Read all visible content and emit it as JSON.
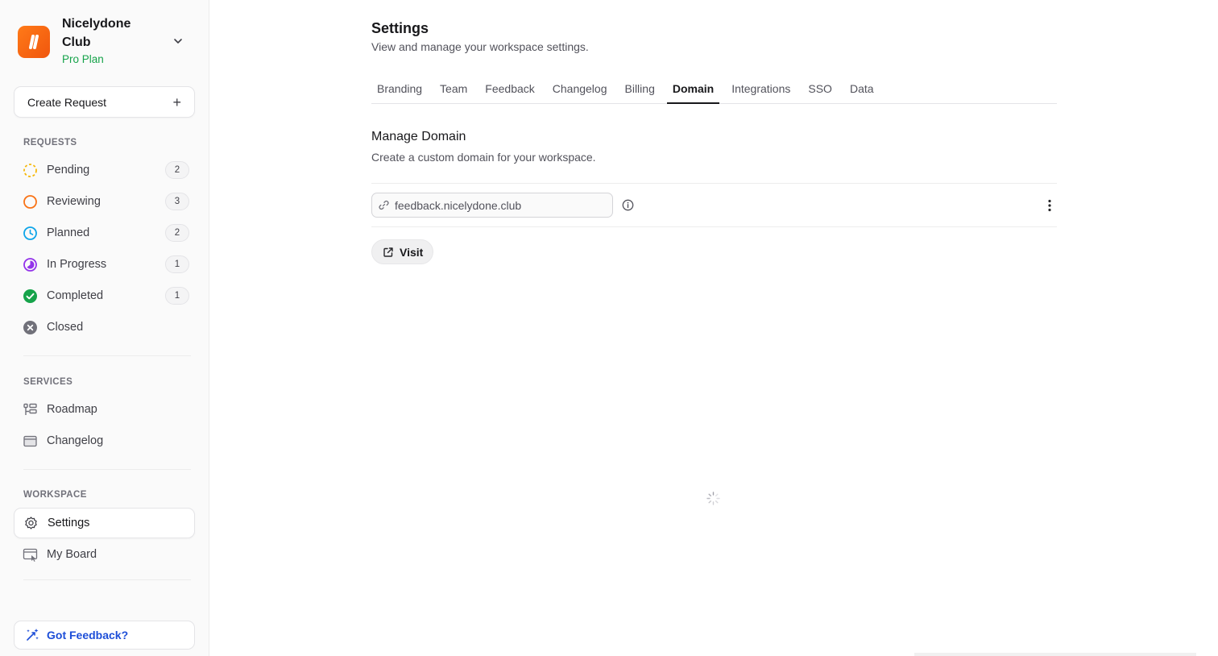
{
  "workspace": {
    "name": "Nicelydone Club",
    "plan": "Pro Plan",
    "accent": "#f97316"
  },
  "sidebar": {
    "create_label": "Create Request",
    "requests_label": "REQUESTS",
    "requests": [
      {
        "label": "Pending",
        "count": "2",
        "icon": "pending-dashed-circle-icon",
        "color": "#f5b80b"
      },
      {
        "label": "Reviewing",
        "count": "3",
        "icon": "reviewing-circle-icon",
        "color": "#f97316"
      },
      {
        "label": "Planned",
        "count": "2",
        "icon": "planned-clock-icon",
        "color": "#0ea5e9"
      },
      {
        "label": "In Progress",
        "count": "1",
        "icon": "in-progress-half-circle-icon",
        "color": "#9333ea"
      },
      {
        "label": "Completed",
        "count": "1",
        "icon": "completed-check-circle-icon",
        "color": "#16a34a"
      },
      {
        "label": "Closed",
        "icon": "closed-x-circle-icon",
        "color": "#71717a"
      }
    ],
    "services_label": "SERVICES",
    "services": [
      {
        "label": "Roadmap",
        "icon": "roadmap-icon"
      },
      {
        "label": "Changelog",
        "icon": "changelog-folder-icon"
      }
    ],
    "workspace_label": "WORKSPACE",
    "workspace_items": [
      {
        "label": "Settings",
        "icon": "gear-icon",
        "active": true
      },
      {
        "label": "My Board",
        "icon": "board-icon"
      }
    ],
    "feedback_label": "Got Feedback?"
  },
  "header": {
    "title": "Settings",
    "subtitle": "View and manage your workspace settings."
  },
  "tabs": [
    {
      "label": "Branding"
    },
    {
      "label": "Team"
    },
    {
      "label": "Feedback"
    },
    {
      "label": "Changelog"
    },
    {
      "label": "Billing"
    },
    {
      "label": "Domain",
      "active": true
    },
    {
      "label": "Integrations"
    },
    {
      "label": "SSO"
    },
    {
      "label": "Data"
    }
  ],
  "domain": {
    "title": "Manage Domain",
    "subtitle": "Create a custom domain for your workspace.",
    "value": "feedback.nicelydone.club",
    "visit_label": "Visit"
  }
}
